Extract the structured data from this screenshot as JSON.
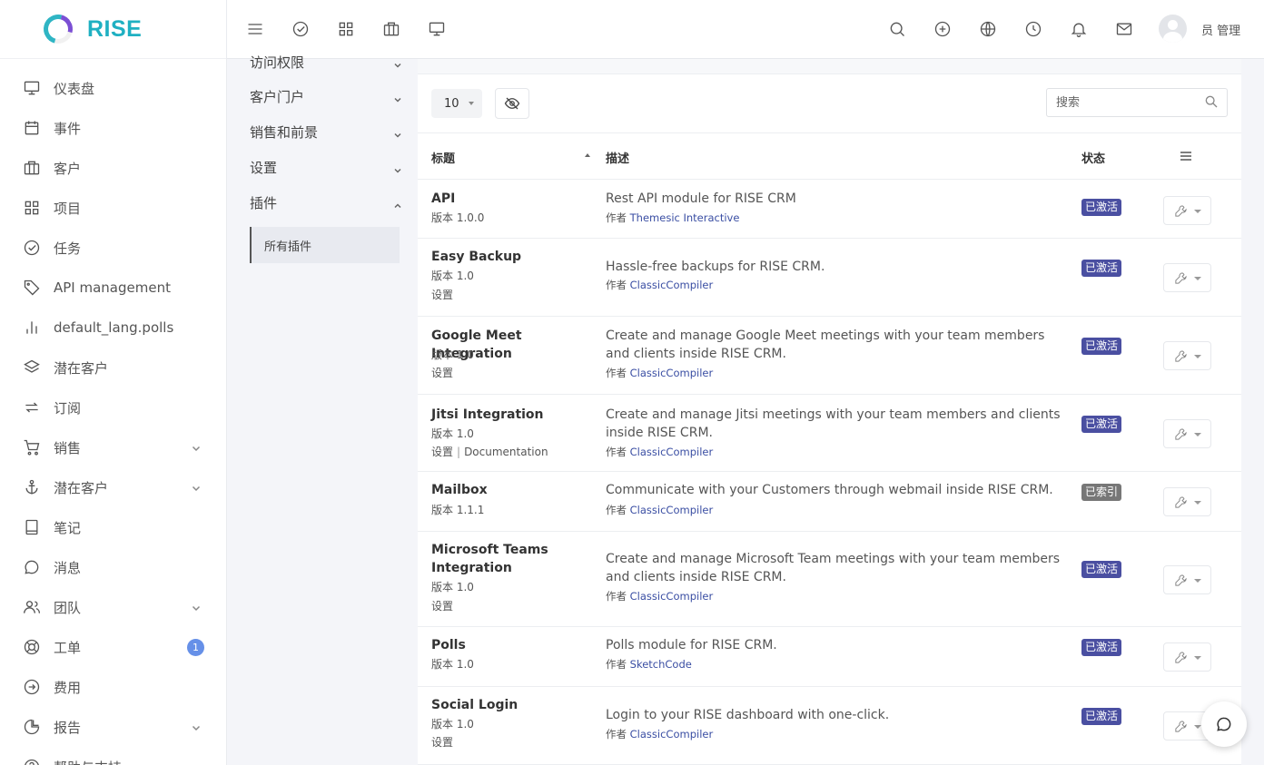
{
  "app": {
    "name": "RISE"
  },
  "header": {
    "user": "员 管理"
  },
  "sidebar": {
    "items": [
      {
        "label": "仪表盘",
        "icon": "monitor-icon"
      },
      {
        "label": "事件",
        "icon": "calendar-icon"
      },
      {
        "label": "客户",
        "icon": "briefcase-icon"
      },
      {
        "label": "项目",
        "icon": "grid-icon"
      },
      {
        "label": "任务",
        "icon": "check-circle-icon"
      },
      {
        "label": "API management",
        "icon": "tag-icon"
      },
      {
        "label": "default_lang.polls",
        "icon": "bar-chart-icon"
      },
      {
        "label": "潜在客户",
        "icon": "layers-icon"
      },
      {
        "label": "订阅",
        "icon": "repeat-icon"
      },
      {
        "label": "销售",
        "icon": "cart-icon",
        "has_sub": true
      },
      {
        "label": "潜在客户",
        "icon": "anchor-icon",
        "has_sub": true
      },
      {
        "label": "笔记",
        "icon": "book-icon"
      },
      {
        "label": "消息",
        "icon": "message-icon"
      },
      {
        "label": "团队",
        "icon": "users-icon",
        "has_sub": true
      },
      {
        "label": "工单",
        "icon": "lifebuoy-icon",
        "badge": "1"
      },
      {
        "label": "费用",
        "icon": "arrow-circle-icon"
      },
      {
        "label": "报告",
        "icon": "pie-chart-icon",
        "has_sub": true
      },
      {
        "label": "帮助与支持",
        "icon": "help-icon"
      }
    ]
  },
  "subnav": {
    "items": [
      {
        "label": "访问权限"
      },
      {
        "label": "客户门户"
      },
      {
        "label": "销售和前景"
      },
      {
        "label": "设置"
      },
      {
        "label": "插件",
        "expanded": true
      }
    ],
    "active": "所有插件"
  },
  "toolbar": {
    "page_size": "10",
    "search_placeholder": "搜索"
  },
  "table": {
    "headers": {
      "title": "标题",
      "description": "描述",
      "status": "状态"
    },
    "rows": [
      {
        "title": "API",
        "version": "版本 1.0.0",
        "settings": "",
        "doc": "",
        "desc": "Rest API module for RISE CRM",
        "author_prefix": "作者",
        "author": "Themesic Interactive",
        "status": "已激活",
        "status_kind": "active"
      },
      {
        "title": "Easy Backup",
        "version": "版本 1.0",
        "settings": "设置",
        "doc": "",
        "desc": "Hassle-free backups for RISE CRM.",
        "author_prefix": "作者",
        "author": "ClassicCompiler",
        "status": "已激活",
        "status_kind": "active"
      },
      {
        "title": "Google Meet Integration",
        "version": "版本 1.0",
        "settings": "设置",
        "doc": "",
        "desc": "Create and manage Google Meet meetings with your team members and clients inside RISE CRM.",
        "author_prefix": "作者",
        "author": "ClassicCompiler",
        "status": "已激活",
        "status_kind": "active"
      },
      {
        "title": "Jitsi Integration",
        "version": "版本 1.0",
        "settings": "设置",
        "doc": "Documentation",
        "desc": "Create and manage Jitsi meetings with your team members and clients inside RISE CRM.",
        "author_prefix": "作者",
        "author": "ClassicCompiler",
        "status": "已激活",
        "status_kind": "active"
      },
      {
        "title": "Mailbox",
        "version": "版本 1.1.1",
        "settings": "",
        "doc": "",
        "desc": "Communicate with your Customers through webmail inside RISE CRM.",
        "author_prefix": "作者",
        "author": "ClassicCompiler",
        "status": "已索引",
        "status_kind": "indexed"
      },
      {
        "title": "Microsoft Teams Integration",
        "version": "版本 1.0",
        "settings": "设置",
        "doc": "",
        "desc": "Create and manage Microsoft Team meetings with your team members and clients inside RISE CRM.",
        "author_prefix": "作者",
        "author": "ClassicCompiler",
        "status": "已激活",
        "status_kind": "active"
      },
      {
        "title": "Polls",
        "version": "版本 1.0",
        "settings": "",
        "doc": "",
        "desc": "Polls module for RISE CRM.",
        "author_prefix": "作者",
        "author": "SketchCode",
        "status": "已激活",
        "status_kind": "active"
      },
      {
        "title": "Social Login",
        "version": "版本 1.0",
        "settings": "设置",
        "doc": "",
        "desc": "Login to your RISE dashboard with one-click.",
        "author_prefix": "作者",
        "author": "ClassicCompiler",
        "status": "已激活",
        "status_kind": "active"
      }
    ]
  },
  "colors": {
    "brand": "#1fb0c2",
    "status_active": "#4a4fa1",
    "status_indexed": "#777777",
    "badge": "#6690e8"
  }
}
